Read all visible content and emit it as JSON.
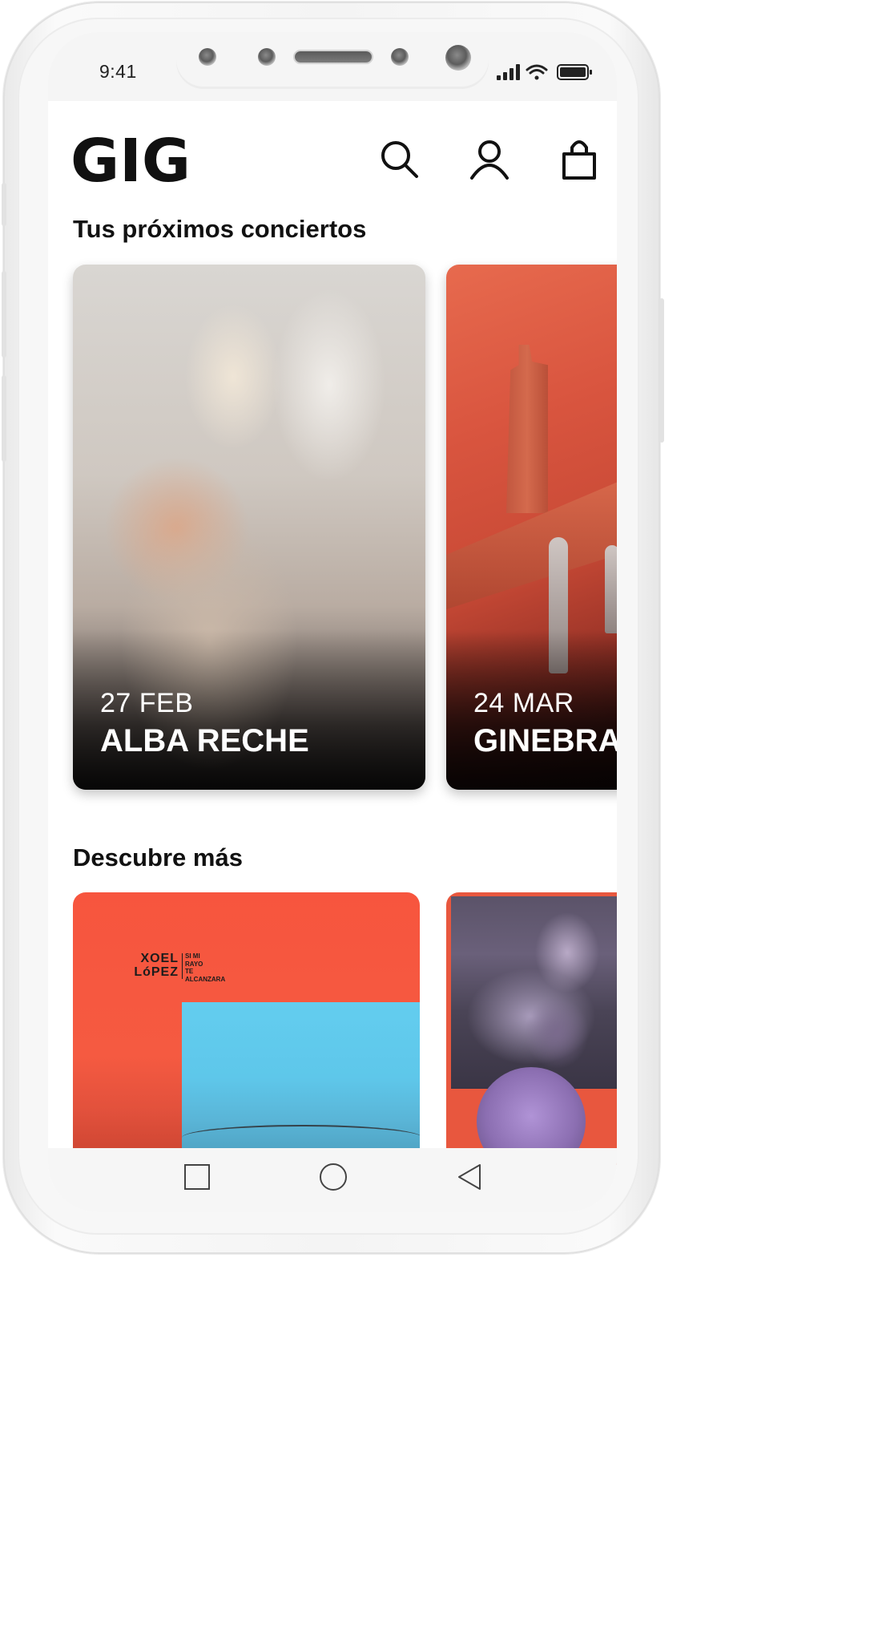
{
  "status_bar": {
    "time": "9:41"
  },
  "header": {
    "logo_text": "GIG",
    "icons": [
      "search-icon",
      "user-icon",
      "shopping-bag-icon"
    ]
  },
  "sections": {
    "upcoming_title": "Tus próximos conciertos",
    "discover_title": "Descubre más"
  },
  "concerts": [
    {
      "date": "27 FEB",
      "name": "ALBA RECHE"
    },
    {
      "date": "24 MAR",
      "name": "GINEBRAS"
    }
  ],
  "discover": [
    {
      "artist_line1": "XOEL",
      "artist_line2": "LóPEZ",
      "album_title": "SI MI\nRAYO\nTE\nALCANZARA"
    }
  ],
  "nav_bar": {
    "icons": [
      "recents-square-icon",
      "home-circle-icon",
      "back-triangle-icon"
    ]
  },
  "colors": {
    "text_primary": "#111111",
    "card_text": "#ffffff",
    "discover_red": "#f7553e",
    "discover_blue": "#63cdef"
  }
}
